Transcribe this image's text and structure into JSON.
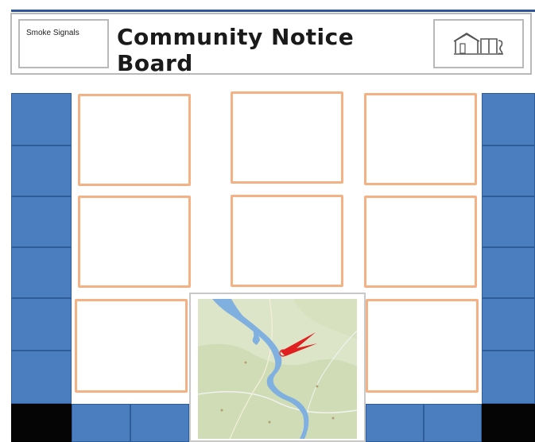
{
  "header": {
    "brand_label": "Smoke Signals",
    "title": "Community Notice Board",
    "logo_icon": "house-logo-icon"
  },
  "notice_slots": {
    "count": 8
  },
  "map": {
    "icon": "map-location-icon"
  },
  "colors": {
    "tile_blue": "#4a7ebf",
    "tile_dark": "#050505",
    "panel_border": "#f4b183",
    "header_border": "#b9b9b9",
    "marker_red": "#e02020"
  }
}
